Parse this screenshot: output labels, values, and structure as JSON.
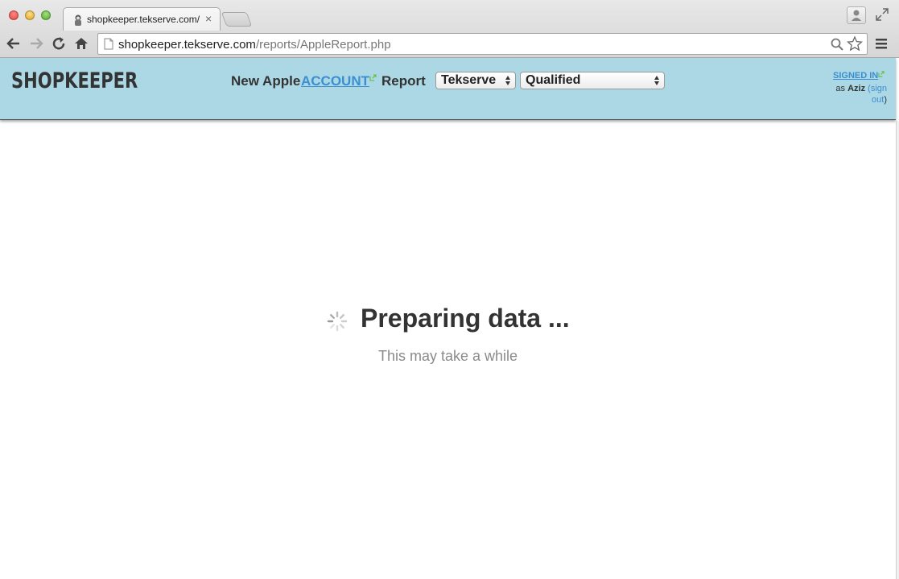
{
  "browser": {
    "tab_title": "shopkeeper.tekserve.com/",
    "tab_close": "×",
    "url_host": "shopkeeper.tekserve.com",
    "url_path": "/reports/AppleReport.php"
  },
  "header": {
    "logo": "SHOPKEEPER",
    "title_prefix": "New Apple",
    "title_link": "ACCOUNT",
    "title_suffix": "Report",
    "store_select": "Tekserve",
    "status_select": "Qualified",
    "signed_in": "SIGNED IN",
    "as_prefix": "as",
    "user": "Aziz",
    "sign_out_a": "(sign",
    "sign_out_b": "out",
    "sign_out_close": ")",
    "accent_color": "#3b8ed0",
    "header_bg": "#acd8e6",
    "external_icon_color": "#6cc04a"
  },
  "main": {
    "heading": "Preparing data ...",
    "subtext": "This may take a while"
  }
}
